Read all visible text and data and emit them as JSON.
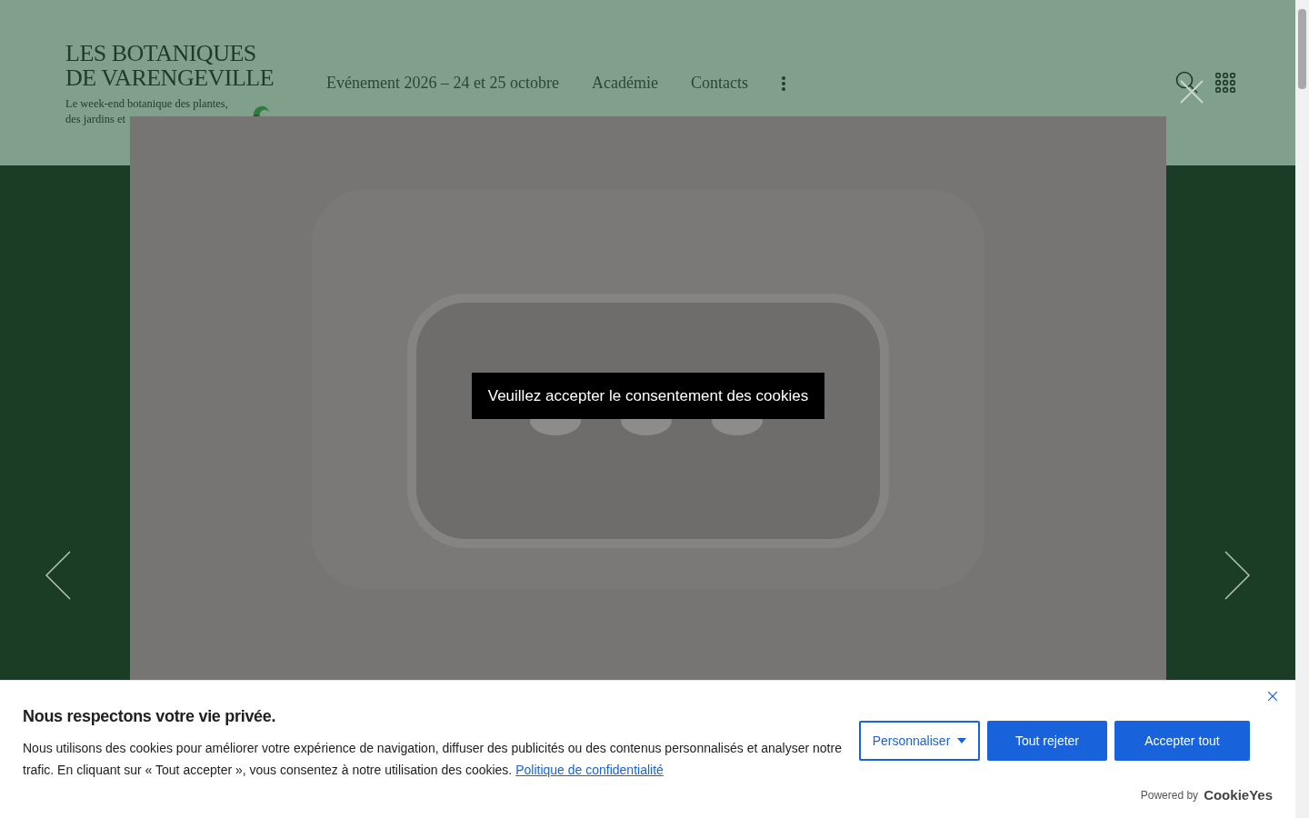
{
  "site": {
    "title_lines": [
      "LES BOTANIQUES",
      "DE VARENGEVILLE"
    ],
    "tagline": "Le week-end botanique des plantes, des jardins et"
  },
  "nav": [
    {
      "label": "Evénement 2026 – 24 et 25 octobre"
    },
    {
      "label": "Académie"
    },
    {
      "label": "Contacts"
    }
  ],
  "lightbox": {
    "message": "Veuillez accepter le consentement des cookies"
  },
  "cookie_banner": {
    "title": "Nous respectons votre vie privée.",
    "text": "Nous utilisons des cookies pour améliorer votre expérience de navigation, diffuser des publicités ou des contenus personnalisés et analyser notre trafic. En cliquant sur « Tout accepter », vous consentez à notre utilisation des cookies.",
    "link": "Politique de confidentialité",
    "buttons": [
      {
        "label": "Personnaliser",
        "kind": "outline"
      },
      {
        "label": "Tout rejeter",
        "kind": "filled"
      },
      {
        "label": "Accepter tout",
        "kind": "filled"
      }
    ],
    "powered_by": "Powered by",
    "brand": "CookieYes"
  }
}
